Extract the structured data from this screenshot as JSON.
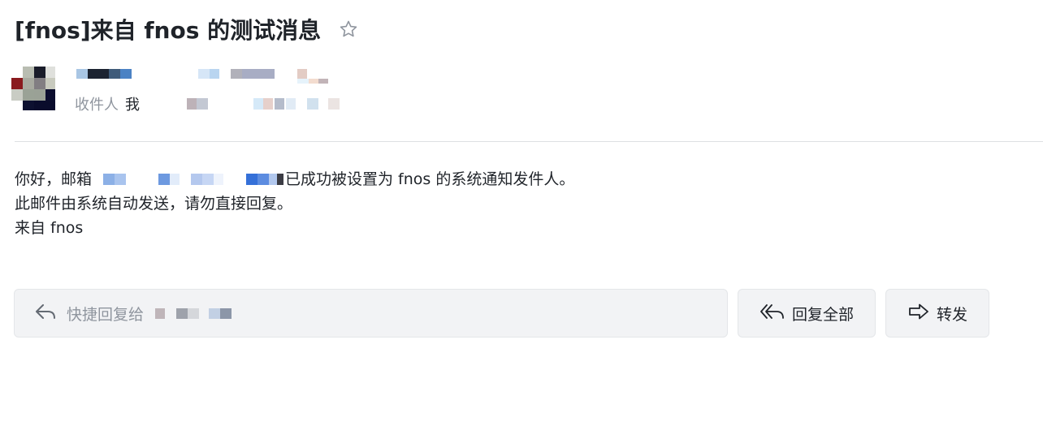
{
  "email": {
    "subject": "[fnos]来自 fnos 的测试消息",
    "recipient_label": "收件人",
    "recipient_me": "我",
    "body": {
      "line1_prefix": "你好，邮箱",
      "line1_suffix": "已成功被设置为 fnos 的系统通知发件人。",
      "line2": "此邮件由系统自动发送，请勿直接回复。",
      "line3": "来自 fnos"
    }
  },
  "actions": {
    "quick_reply_label": "快捷回复给",
    "reply_all_label": "回复全部",
    "forward_label": "转发"
  },
  "icons": {
    "star": "star-outline-icon",
    "reply": "reply-arrow-icon",
    "reply_all": "reply-all-arrow-icon",
    "forward": "forward-arrow-icon"
  },
  "colors": {
    "text_primary": "#1f2329",
    "text_secondary": "#8f959e",
    "button_bg": "#f2f3f5",
    "divider": "#dee0e3"
  }
}
